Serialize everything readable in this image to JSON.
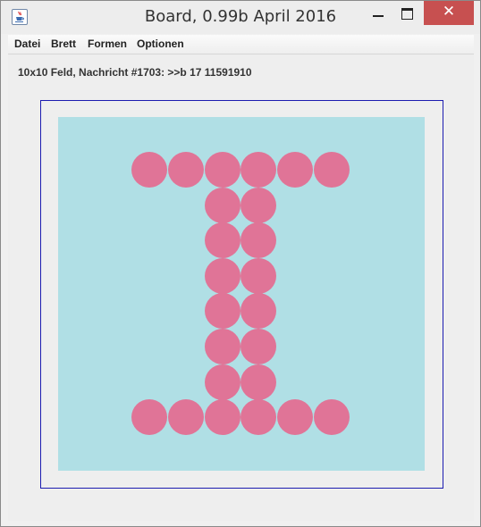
{
  "window": {
    "title": "Board, 0.99b April 2016",
    "close_glyph": "✕",
    "app_icon": "java-coffee-cup-icon"
  },
  "menu": [
    {
      "label": "Datei"
    },
    {
      "label": "Brett"
    },
    {
      "label": "Formen"
    },
    {
      "label": "Optionen"
    }
  ],
  "status_text": "10x10 Feld, Nachricht #1703: >>b 17 11591910",
  "board": {
    "rows": 10,
    "cols": 10,
    "background": "#b0dfe5",
    "piece_color": "#e07497",
    "frame_color": "#1c1cb0",
    "filled": [
      [
        0,
        0,
        0,
        0,
        0,
        0,
        0,
        0,
        0,
        0
      ],
      [
        0,
        0,
        1,
        1,
        1,
        1,
        1,
        1,
        0,
        0
      ],
      [
        0,
        0,
        0,
        0,
        1,
        1,
        0,
        0,
        0,
        0
      ],
      [
        0,
        0,
        0,
        0,
        1,
        1,
        0,
        0,
        0,
        0
      ],
      [
        0,
        0,
        0,
        0,
        1,
        1,
        0,
        0,
        0,
        0
      ],
      [
        0,
        0,
        0,
        0,
        1,
        1,
        0,
        0,
        0,
        0
      ],
      [
        0,
        0,
        0,
        0,
        1,
        1,
        0,
        0,
        0,
        0
      ],
      [
        0,
        0,
        0,
        0,
        1,
        1,
        0,
        0,
        0,
        0
      ],
      [
        0,
        0,
        1,
        1,
        1,
        1,
        1,
        1,
        0,
        0
      ],
      [
        0,
        0,
        0,
        0,
        0,
        0,
        0,
        0,
        0,
        0
      ]
    ]
  }
}
